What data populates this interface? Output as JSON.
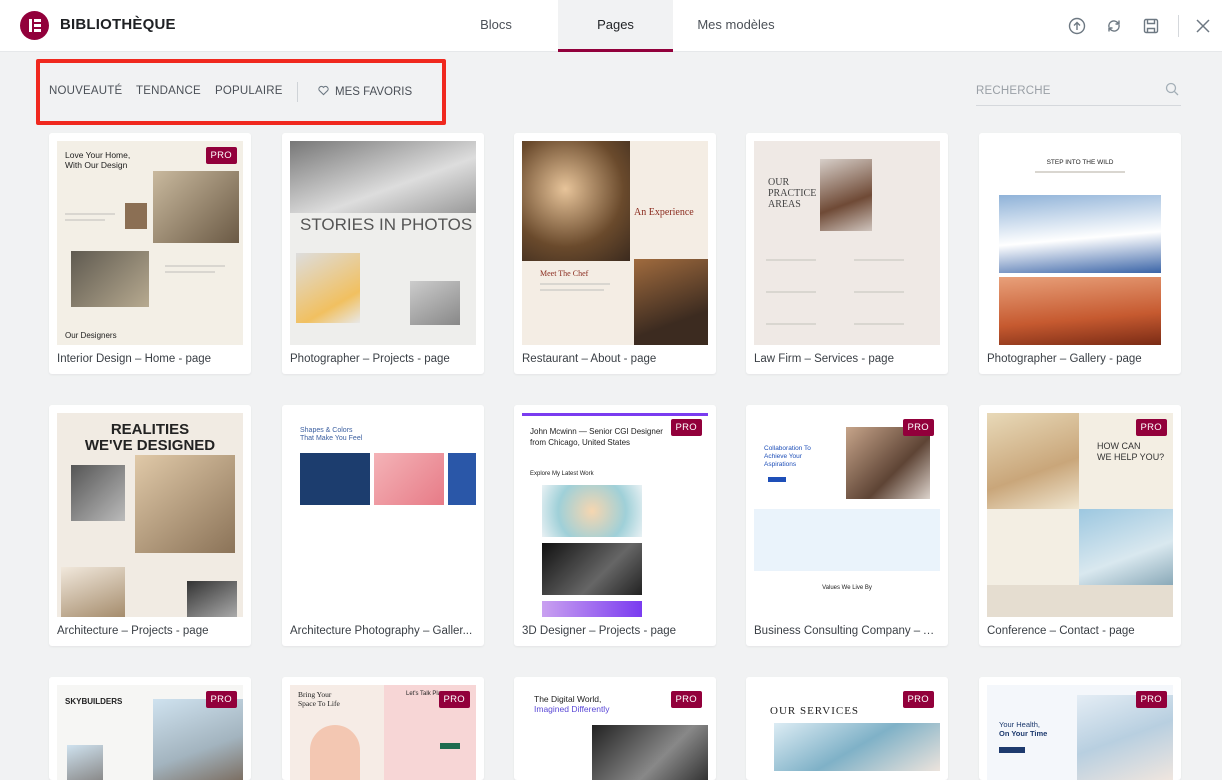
{
  "app": {
    "title": "BIBLIOTHÈQUE",
    "logo_icon": "elementor-logo-icon",
    "accent": "#92003b"
  },
  "tabs": [
    {
      "label": "Blocs",
      "active": false
    },
    {
      "label": "Pages",
      "active": true
    },
    {
      "label": "Mes modèles",
      "active": false
    }
  ],
  "toolbar": {
    "icons": [
      "upload-icon",
      "sync-icon",
      "save-icon",
      "close-icon"
    ]
  },
  "filters": {
    "items": [
      "NOUVEAUTÉ",
      "TENDANCE",
      "POPULAIRE"
    ],
    "favorites": "MES FAVORIS",
    "favorites_icon": "heart-icon"
  },
  "search": {
    "placeholder": "RECHERCHE",
    "icon": "search-icon"
  },
  "pro_label": "PRO",
  "templates": [
    {
      "title": "Interior Design – Home - page",
      "pro": true,
      "preview": [
        "Love Your Home,",
        "With Our Design",
        "Our Designers"
      ]
    },
    {
      "title": "Photographer – Projects - page",
      "pro": false,
      "preview": [
        "STORIES IN PHOTOS"
      ]
    },
    {
      "title": "Restaurant – About - page",
      "pro": false,
      "preview": [
        "An Experience",
        "Meet The Chef"
      ]
    },
    {
      "title": "Law Firm – Services - page",
      "pro": false,
      "preview": [
        "OUR",
        "PRACTICE",
        "AREAS"
      ]
    },
    {
      "title": "Photographer – Gallery - page",
      "pro": false,
      "preview": [
        "STEP INTO THE WILD"
      ]
    },
    {
      "title": "Architecture – Projects - page",
      "pro": false,
      "preview": [
        "REALITIES",
        "WE'VE DESIGNED"
      ]
    },
    {
      "title": "Architecture Photography – Galler...",
      "pro": false,
      "preview": [
        "Shapes & Colors",
        "That Make You Feel"
      ]
    },
    {
      "title": "3D Designer – Projects - page",
      "pro": true,
      "preview": [
        "John Mcwinn — Senior CGI Designer",
        "from Chicago, United States",
        "Explore My Latest Work"
      ]
    },
    {
      "title": "Business Consulting Company – A...",
      "pro": true,
      "preview": [
        "Collaboration To",
        "Achieve Your",
        "Aspirations",
        "Values We Live By"
      ]
    },
    {
      "title": "Conference – Contact - page",
      "pro": true,
      "preview": [
        "HOW CAN",
        "WE HELP YOU?"
      ]
    },
    {
      "title": "",
      "pro": true,
      "preview": [
        "SKYBUILDERS"
      ]
    },
    {
      "title": "",
      "pro": true,
      "preview": [
        "Bring Your",
        "Space To Life",
        "Let's Talk Plans"
      ]
    },
    {
      "title": "",
      "pro": true,
      "preview": [
        "The Digital World,",
        "Imagined Differently"
      ]
    },
    {
      "title": "",
      "pro": true,
      "preview": [
        "OUR SERVICES"
      ]
    },
    {
      "title": "",
      "pro": true,
      "preview": [
        "Your Health,",
        "On Your Time"
      ]
    }
  ]
}
